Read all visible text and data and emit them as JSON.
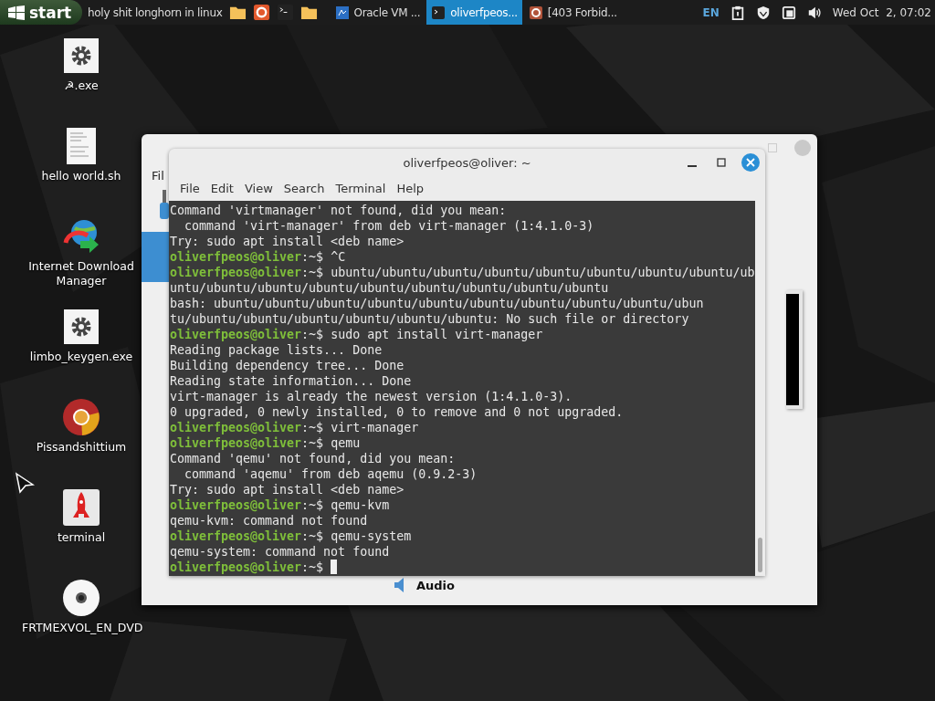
{
  "taskbar": {
    "start_label": "start",
    "pinned_text": "holy shit longhorn in linux",
    "windows": [
      {
        "label": "Oracle VM ...",
        "kind": "vbox",
        "selected": false
      },
      {
        "label": "oliverfpeos...",
        "kind": "terminal",
        "selected": true
      },
      {
        "label": "[403 Forbid...",
        "kind": "browser",
        "selected": false
      }
    ],
    "tray": {
      "language": "EN",
      "clock": "Wed Oct  2, 07:02"
    }
  },
  "desktop_icons": [
    {
      "label": "☭.exe",
      "kind": "gear"
    },
    {
      "label": "hello world.sh",
      "kind": "document"
    },
    {
      "label": "Internet Download Manager",
      "kind": "downloader"
    },
    {
      "label": "limbo_keygen.exe",
      "kind": "gear"
    },
    {
      "label": "Pissandshittium",
      "kind": "browser"
    },
    {
      "label": "terminal",
      "kind": "rocket"
    },
    {
      "label": "FRTMEXVOL_EN_DVD",
      "kind": "disc"
    }
  ],
  "background_window": {
    "menu": "Fil",
    "section": "Audio"
  },
  "terminal": {
    "title": "oliverfpeos@oliver: ~",
    "menu": [
      "File",
      "Edit",
      "View",
      "Search",
      "Terminal",
      "Help"
    ],
    "lines": [
      {
        "kind": "output",
        "text": "Command 'virtmanager' not found, did you mean:"
      },
      {
        "kind": "output",
        "text": "  command 'virt-manager' from deb virt-manager (1:4.1.0-3)"
      },
      {
        "kind": "output",
        "text": "Try: sudo apt install <deb name>"
      },
      {
        "kind": "prompt",
        "user": "oliverfpeos@oliver",
        "path": ":~$",
        "command": "^C"
      },
      {
        "kind": "prompt",
        "user": "oliverfpeos@oliver",
        "path": ":~$",
        "command": "ubuntu/ubuntu/ubuntu/ubuntu/ubuntu/ubuntu/ubuntu/ubuntu/ub"
      },
      {
        "kind": "output",
        "text": "untu/ubuntu/ubuntu/ubuntu/ubuntu/ubuntu/ubuntu/ubuntu/ubuntu"
      },
      {
        "kind": "output",
        "text": "bash: ubuntu/ubuntu/ubuntu/ubuntu/ubuntu/ubuntu/ubuntu/ubuntu/ubuntu/ubun"
      },
      {
        "kind": "output",
        "text": "tu/ubuntu/ubuntu/ubuntu/ubuntu/ubuntu/ubuntu: No such file or directory"
      },
      {
        "kind": "prompt",
        "user": "oliverfpeos@oliver",
        "path": ":~$",
        "command": "sudo apt install virt-manager"
      },
      {
        "kind": "output",
        "text": "Reading package lists... Done"
      },
      {
        "kind": "output",
        "text": "Building dependency tree... Done"
      },
      {
        "kind": "output",
        "text": "Reading state information... Done"
      },
      {
        "kind": "output",
        "text": "virt-manager is already the newest version (1:4.1.0-3)."
      },
      {
        "kind": "output",
        "text": "0 upgraded, 0 newly installed, 0 to remove and 0 not upgraded."
      },
      {
        "kind": "prompt",
        "user": "oliverfpeos@oliver",
        "path": ":~$",
        "command": "virt-manager"
      },
      {
        "kind": "prompt",
        "user": "oliverfpeos@oliver",
        "path": ":~$",
        "command": "qemu"
      },
      {
        "kind": "output",
        "text": "Command 'qemu' not found, did you mean:"
      },
      {
        "kind": "output",
        "text": "  command 'aqemu' from deb aqemu (0.9.2-3)"
      },
      {
        "kind": "output",
        "text": "Try: sudo apt install <deb name>"
      },
      {
        "kind": "prompt",
        "user": "oliverfpeos@oliver",
        "path": ":~$",
        "command": "qemu-kvm"
      },
      {
        "kind": "output",
        "text": "qemu-kvm: command not found"
      },
      {
        "kind": "prompt",
        "user": "oliverfpeos@oliver",
        "path": ":~$",
        "command": "qemu-system"
      },
      {
        "kind": "output",
        "text": "qemu-system: command not found"
      },
      {
        "kind": "cursor",
        "user": "oliverfpeos@oliver",
        "path": ":~$"
      }
    ]
  }
}
